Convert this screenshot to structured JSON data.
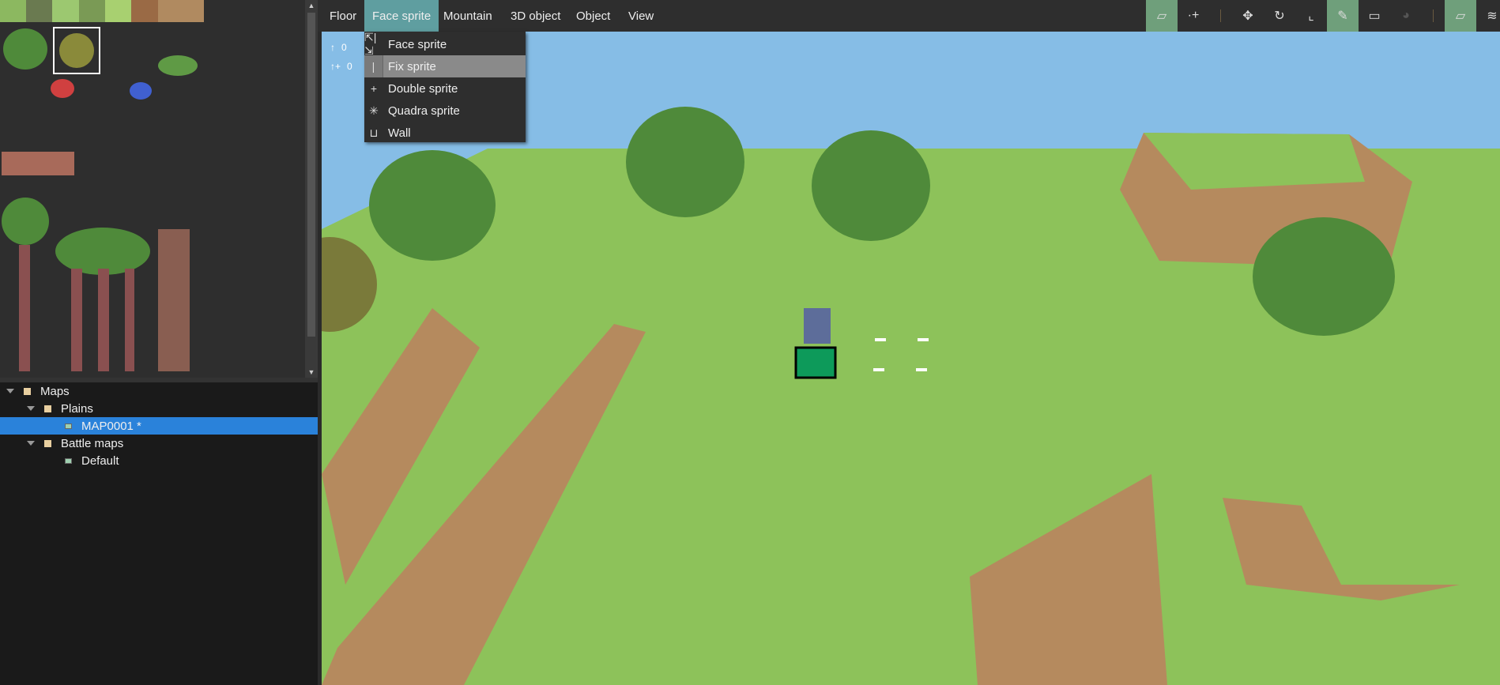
{
  "menubar": {
    "items": [
      "Floor",
      "Face sprite",
      "Mountain",
      "3D object",
      "Object",
      "View"
    ],
    "active": "Face sprite"
  },
  "dropdown": {
    "items": [
      {
        "label": "Face sprite",
        "icon": "face-sprite-icon",
        "glyph": "⇱|⇲"
      },
      {
        "label": "Fix sprite",
        "icon": "fix-sprite-icon",
        "glyph": "|"
      },
      {
        "label": "Double sprite",
        "icon": "double-sprite-icon",
        "glyph": "+"
      },
      {
        "label": "Quadra sprite",
        "icon": "quadra-sprite-icon",
        "glyph": "✳"
      },
      {
        "label": "Wall",
        "icon": "wall-icon",
        "glyph": "⊔"
      }
    ],
    "highlighted": "Fix sprite"
  },
  "counters": [
    {
      "icon": "arrow-up-icon",
      "glyph": "↑",
      "value": "0"
    },
    {
      "icon": "arrow-up-plus-icon",
      "glyph": "↑+",
      "value": "0"
    }
  ],
  "toolbar": [
    {
      "name": "add-layer",
      "glyph": "▱",
      "on": true
    },
    {
      "name": "add-point",
      "glyph": "·+",
      "on": false
    },
    {
      "name": "translate",
      "glyph": "✥",
      "on": false
    },
    {
      "name": "rotate",
      "glyph": "↻",
      "on": false
    },
    {
      "name": "scale",
      "glyph": "⌞",
      "on": false
    },
    {
      "name": "pencil",
      "glyph": "✎",
      "on": true
    },
    {
      "name": "rectangle",
      "glyph": "▭",
      "on": false
    },
    {
      "name": "paint-bucket",
      "glyph": "◕",
      "on": false
    },
    {
      "name": "layer-on",
      "glyph": "▱",
      "on": true
    },
    {
      "name": "layers",
      "glyph": "≋",
      "on": false
    }
  ],
  "tree": [
    {
      "label": "Maps",
      "type": "folder",
      "depth": 0,
      "expanded": true
    },
    {
      "label": "Plains",
      "type": "folder",
      "depth": 1,
      "expanded": true
    },
    {
      "label": "MAP0001 *",
      "type": "map",
      "depth": 2,
      "selected": true
    },
    {
      "label": "Battle maps",
      "type": "folder",
      "depth": 1,
      "expanded": true
    },
    {
      "label": "Default",
      "type": "map",
      "depth": 2
    }
  ],
  "colors": {
    "accent": "#5f9ea0",
    "toolbar_on": "#6f9f7b",
    "selection": "#2a82da",
    "sky": "#86bde6",
    "grass": "#8dc25a",
    "dirt": "#b58a5e"
  }
}
